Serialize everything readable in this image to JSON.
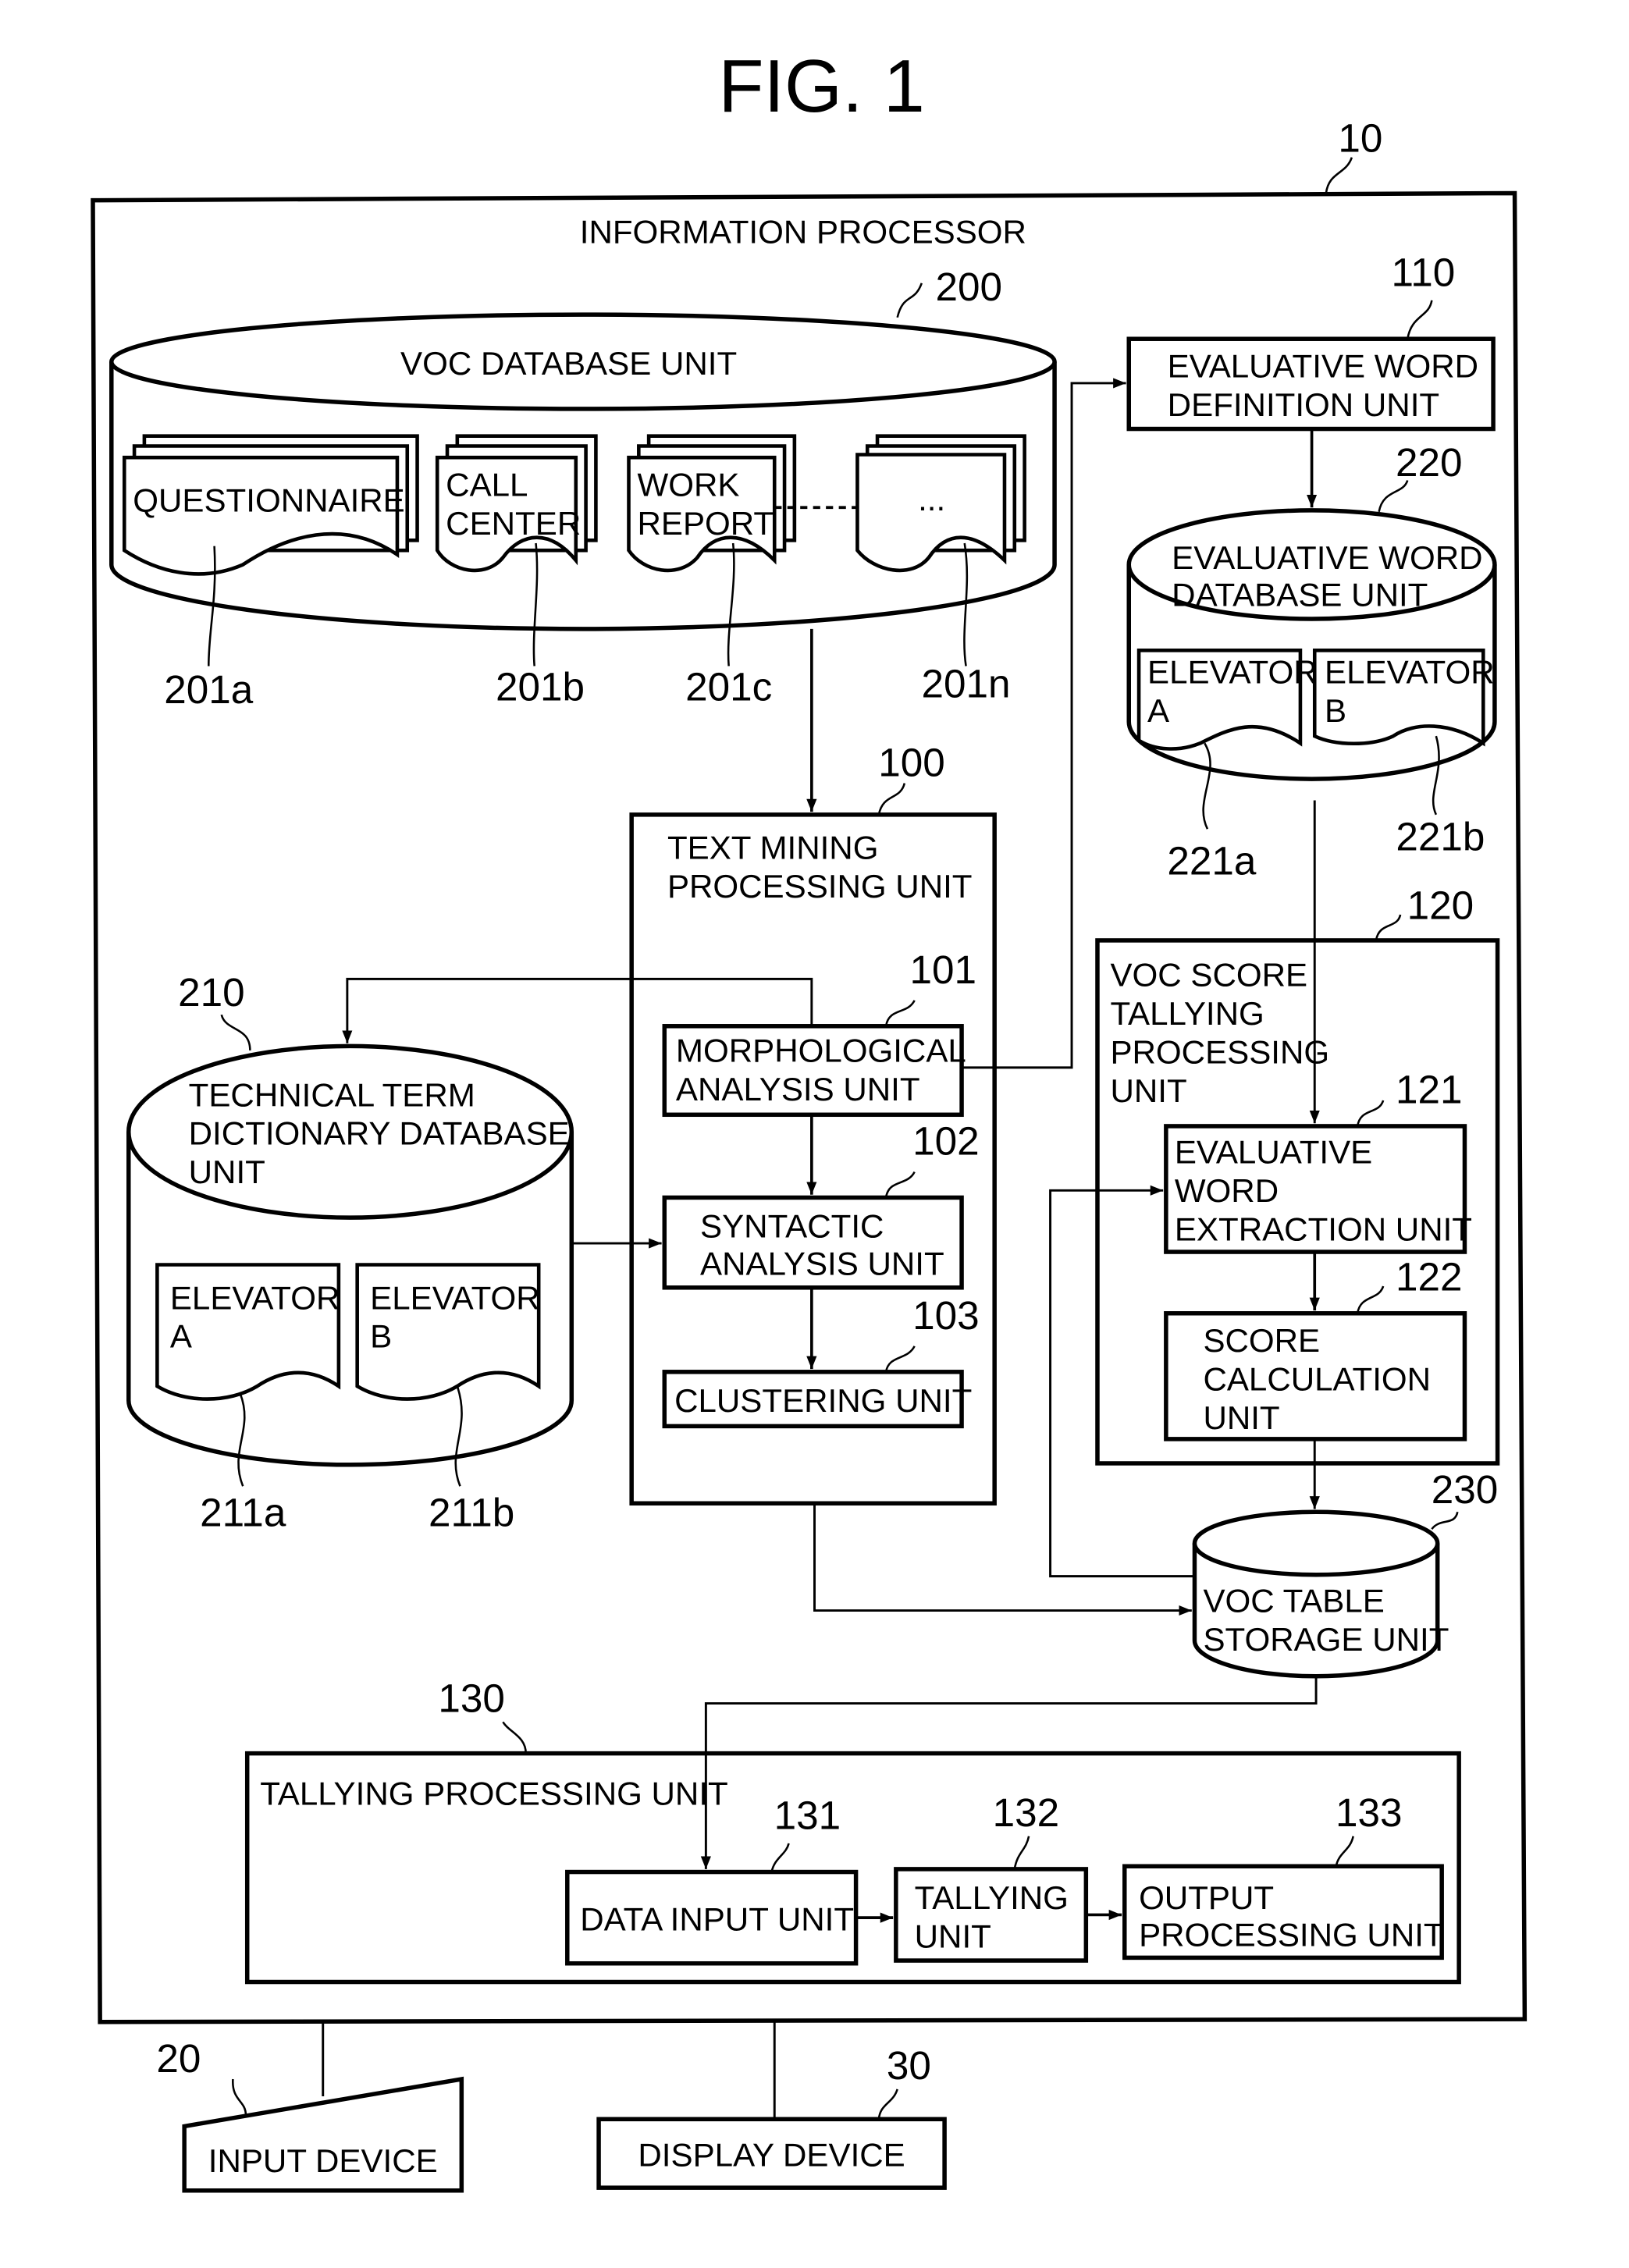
{
  "figure": {
    "title": "FIG. 1"
  },
  "info_processor": {
    "ref": "10",
    "label": "INFORMATION PROCESSOR"
  },
  "voc_db": {
    "ref": "200",
    "label": "VOC DATABASE UNIT",
    "docs": [
      {
        "ref": "201a",
        "lines": [
          "QUESTIONNAIRE"
        ]
      },
      {
        "ref": "201b",
        "lines": [
          "CALL",
          "CENTER"
        ]
      },
      {
        "ref": "201c",
        "lines": [
          "WORK",
          "REPORT"
        ]
      },
      {
        "ref": "201n",
        "lines": [
          "..."
        ]
      }
    ]
  },
  "eval_def": {
    "ref": "110",
    "lines": [
      "EVALUATIVE WORD",
      "DEFINITION UNIT"
    ]
  },
  "eval_db": {
    "ref": "220",
    "lines": [
      "EVALUATIVE WORD",
      "DATABASE UNIT"
    ],
    "docs": [
      {
        "ref": "221a",
        "lines": [
          "ELEVATOR",
          "A"
        ]
      },
      {
        "ref": "221b",
        "lines": [
          "ELEVATOR",
          "B"
        ]
      }
    ]
  },
  "text_mining": {
    "ref": "100",
    "lines": [
      "TEXT MINING",
      "PROCESSING UNIT"
    ],
    "morph": {
      "ref": "101",
      "lines": [
        "MORPHOLOGICAL",
        "ANALYSIS UNIT"
      ]
    },
    "syntactic": {
      "ref": "102",
      "lines": [
        "SYNTACTIC",
        "ANALYSIS UNIT"
      ]
    },
    "clustering": {
      "ref": "103",
      "lines": [
        "CLUSTERING UNIT"
      ]
    }
  },
  "tech_db": {
    "ref": "210",
    "lines": [
      "TECHNICAL TERM",
      "DICTIONARY DATABASE",
      "UNIT"
    ],
    "docs": [
      {
        "ref": "211a",
        "lines": [
          "ELEVATOR",
          "A"
        ]
      },
      {
        "ref": "211b",
        "lines": [
          "ELEVATOR",
          "B"
        ]
      }
    ]
  },
  "voc_score": {
    "ref": "120",
    "lines": [
      "VOC SCORE",
      "TALLYING",
      "PROCESSING",
      "UNIT"
    ],
    "extraction": {
      "ref": "121",
      "lines": [
        "EVALUATIVE",
        "WORD",
        "EXTRACTION UNIT"
      ]
    },
    "score_calc": {
      "ref": "122",
      "lines": [
        "SCORE",
        "CALCULATION",
        "UNIT"
      ]
    }
  },
  "voc_table": {
    "ref": "230",
    "lines": [
      "VOC TABLE",
      "STORAGE UNIT"
    ]
  },
  "tallying": {
    "ref": "130",
    "label": "TALLYING PROCESSING UNIT",
    "data_input": {
      "ref": "131",
      "lines": [
        "DATA INPUT UNIT"
      ]
    },
    "tally_unit": {
      "ref": "132",
      "lines": [
        "TALLYING",
        "UNIT"
      ]
    },
    "output_proc": {
      "ref": "133",
      "lines": [
        "OUTPUT",
        "PROCESSING UNIT"
      ]
    }
  },
  "input_device": {
    "ref": "20",
    "label": "INPUT DEVICE"
  },
  "display_device": {
    "ref": "30",
    "label": "DISPLAY DEVICE"
  }
}
